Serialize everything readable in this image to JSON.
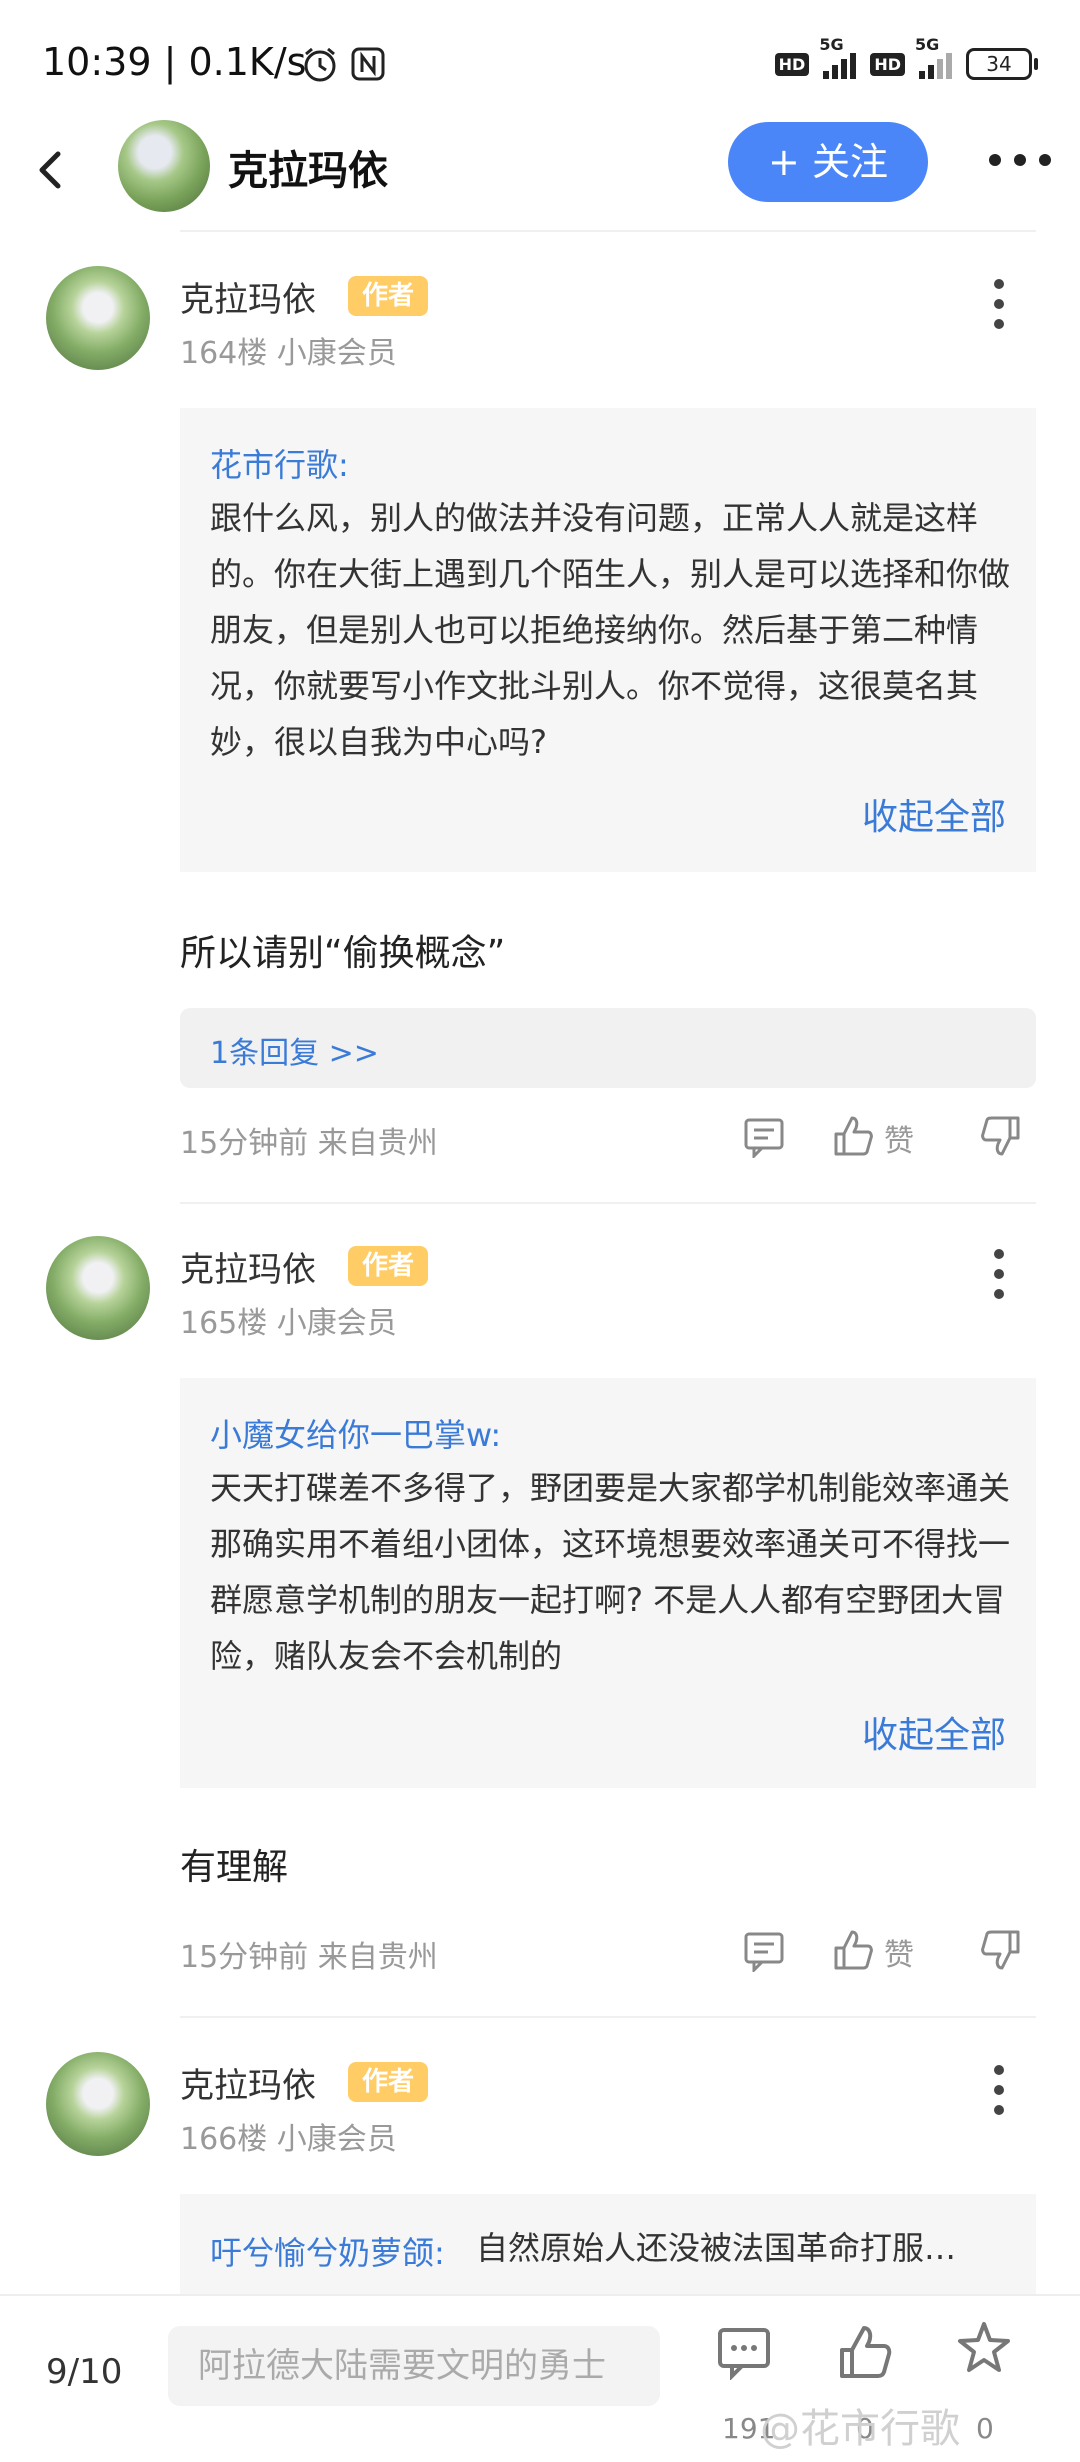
{
  "status_bar": {
    "time_speed": "10:39 | 0.1K/s",
    "battery": "34"
  },
  "nav": {
    "title": "克拉玛依",
    "follow_label": "+ 关注"
  },
  "posts": [
    {
      "user": "克拉玛依",
      "badge": "作者",
      "meta": "164楼  小康会员",
      "quote_author": "花市行歌:",
      "quote_text": "跟什么风，别人的做法并没有问题，正常人人就是这样的。你在大街上遇到几个陌生人，别人是可以选择和你做朋友，但是别人也可以拒绝接纳你。然后基于第二种情况，你就要写小作文批斗别人。你不觉得，这很莫名其妙，很以自我为中心吗?",
      "collapse": "收起全部",
      "reply": "所以请别“偷换概念”",
      "replies_link": "1条回复 >>",
      "time": "15分钟前 来自贵州",
      "like_label": "赞"
    },
    {
      "user": "克拉玛依",
      "badge": "作者",
      "meta": "165楼  小康会员",
      "quote_author": "小魔女给你一巴掌w:",
      "quote_text": "天天打碟差不多得了，野团要是大家都学机制能效率通关那确实用不着组小团体，这环境想要效率通关可不得找一群愿意学机制的朋友一起打啊? 不是人人都有空野团大冒险，赌队友会不会机制的",
      "collapse": "收起全部",
      "reply": "有理解",
      "time": "15分钟前 来自贵州",
      "like_label": "赞"
    },
    {
      "user": "克拉玛依",
      "badge": "作者",
      "meta": "166楼  小康会员",
      "quote_author": "吁兮愉兮奶萝颌:",
      "quote_text": "自然原始人还没被法国革命打服…"
    }
  ],
  "bottom_bar": {
    "page": "9/10",
    "input_placeholder": "阿拉德大陆需要文明的勇士",
    "comments": "191",
    "likes": "0",
    "favorites": "0",
    "watermark": "@花市行歌"
  }
}
